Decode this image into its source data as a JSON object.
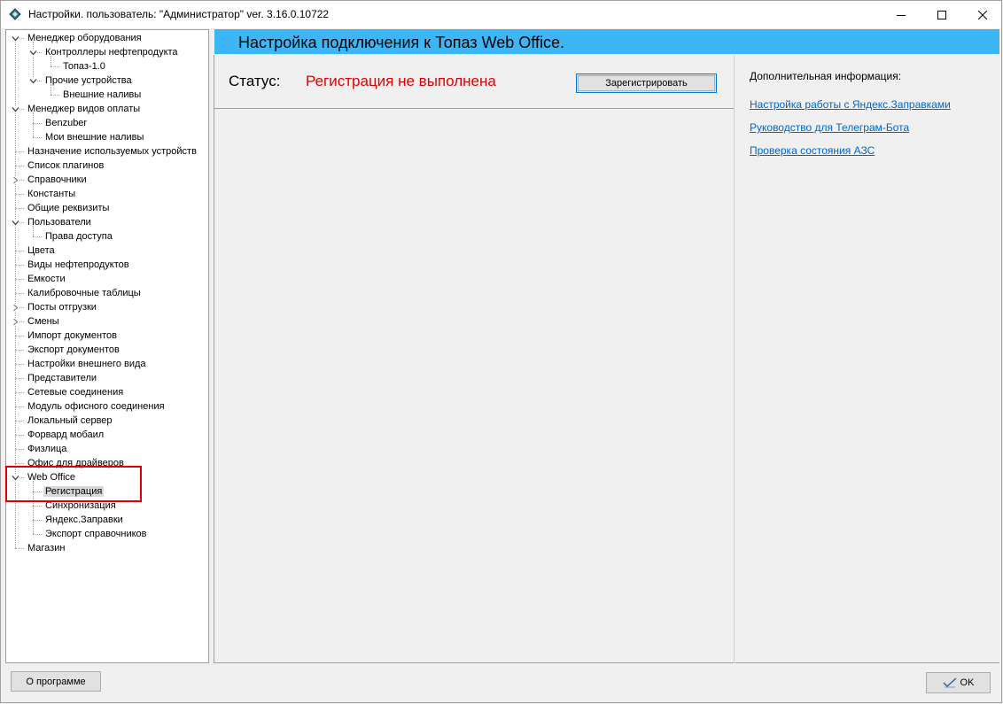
{
  "window": {
    "title": "Настройки. пользователь: \"Администратор\" ver. 3.16.0.10722"
  },
  "tree": [
    {
      "label": "Менеджер оборудования",
      "level": 0,
      "expander": "expanded"
    },
    {
      "label": "Контроллеры нефтепродукта",
      "level": 1,
      "expander": "expanded"
    },
    {
      "label": "Топаз-1.0",
      "level": 2,
      "expander": "none"
    },
    {
      "label": "Прочие устройства",
      "level": 1,
      "expander": "expanded"
    },
    {
      "label": "Внешние наливы",
      "level": 2,
      "expander": "none"
    },
    {
      "label": "Менеджер видов оплаты",
      "level": 0,
      "expander": "expanded"
    },
    {
      "label": "Benzuber",
      "level": 1,
      "expander": "none"
    },
    {
      "label": "Мои внешние наливы",
      "level": 1,
      "expander": "none"
    },
    {
      "label": "Назначение используемых устройств",
      "level": 0,
      "expander": "none"
    },
    {
      "label": "Список плагинов",
      "level": 0,
      "expander": "none"
    },
    {
      "label": "Справочники",
      "level": 0,
      "expander": "collapsed"
    },
    {
      "label": "Константы",
      "level": 0,
      "expander": "none"
    },
    {
      "label": "Общие реквизиты",
      "level": 0,
      "expander": "none"
    },
    {
      "label": "Пользователи",
      "level": 0,
      "expander": "expanded"
    },
    {
      "label": "Права доступа",
      "level": 1,
      "expander": "none"
    },
    {
      "label": "Цвета",
      "level": 0,
      "expander": "none"
    },
    {
      "label": "Виды нефтепродуктов",
      "level": 0,
      "expander": "none"
    },
    {
      "label": "Емкости",
      "level": 0,
      "expander": "none"
    },
    {
      "label": "Калибровочные таблицы",
      "level": 0,
      "expander": "none"
    },
    {
      "label": "Посты отгрузки",
      "level": 0,
      "expander": "collapsed"
    },
    {
      "label": "Смены",
      "level": 0,
      "expander": "collapsed"
    },
    {
      "label": "Импорт документов",
      "level": 0,
      "expander": "none"
    },
    {
      "label": "Экспорт документов",
      "level": 0,
      "expander": "none"
    },
    {
      "label": "Настройки внешнего вида",
      "level": 0,
      "expander": "none"
    },
    {
      "label": "Представители",
      "level": 0,
      "expander": "none"
    },
    {
      "label": "Сетевые соединения",
      "level": 0,
      "expander": "none"
    },
    {
      "label": "Модуль офисного соединения",
      "level": 0,
      "expander": "none"
    },
    {
      "label": "Локальный сервер",
      "level": 0,
      "expander": "none"
    },
    {
      "label": "Форвард мобаил",
      "level": 0,
      "expander": "none"
    },
    {
      "label": "Физлица",
      "level": 0,
      "expander": "none"
    },
    {
      "label": "Офис для драйверов",
      "level": 0,
      "expander": "none"
    },
    {
      "label": "Web Office",
      "level": 0,
      "expander": "expanded"
    },
    {
      "label": "Регистрация",
      "level": 1,
      "expander": "none",
      "selected": true
    },
    {
      "label": "Синхронизация",
      "level": 1,
      "expander": "none"
    },
    {
      "label": "Яндекс.Заправки",
      "level": 1,
      "expander": "none"
    },
    {
      "label": "Экспорт справочников",
      "level": 1,
      "expander": "none"
    },
    {
      "label": "Магазин",
      "level": 0,
      "expander": "none"
    }
  ],
  "header": {
    "title": "Настройка подключения к Топаз Web Office."
  },
  "status": {
    "label": "Статус:",
    "value": "Регистрация не выполнена",
    "register_button": "Зарегистрировать"
  },
  "side": {
    "title": "Дополнительная информация:",
    "links": [
      "Настройка работы с Яндекс.Заправками",
      "Руководство для Телеграм-Бота",
      "Проверка состояния АЗС"
    ]
  },
  "footer": {
    "about_button": "О программе",
    "ok_button": "OK"
  },
  "colors": {
    "header_bg": "#3db6f5",
    "status_error": "#e00000",
    "link": "#0066cc",
    "highlight": "#e00000"
  }
}
